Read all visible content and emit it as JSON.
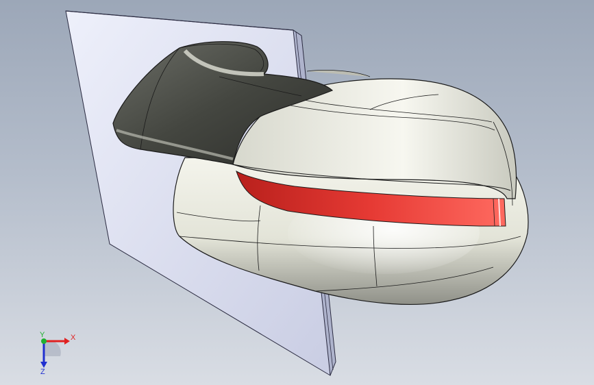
{
  "model": {
    "name": "mirror-housing-assembly",
    "colors": {
      "body": "#e6e7dc",
      "body_shadow": "#8e8f86",
      "dark_shell": "#3f413d",
      "red_strip": "#e03a34",
      "plate": "#dfe2f3",
      "plate_edge": "#9aa0be",
      "edge_line": "#1a1a1a"
    }
  },
  "triad": {
    "x_label": "X",
    "y_label": "Y",
    "z_label": "Z",
    "x_color": "#e02020",
    "y_color": "#20b030",
    "z_color": "#2030d0"
  }
}
